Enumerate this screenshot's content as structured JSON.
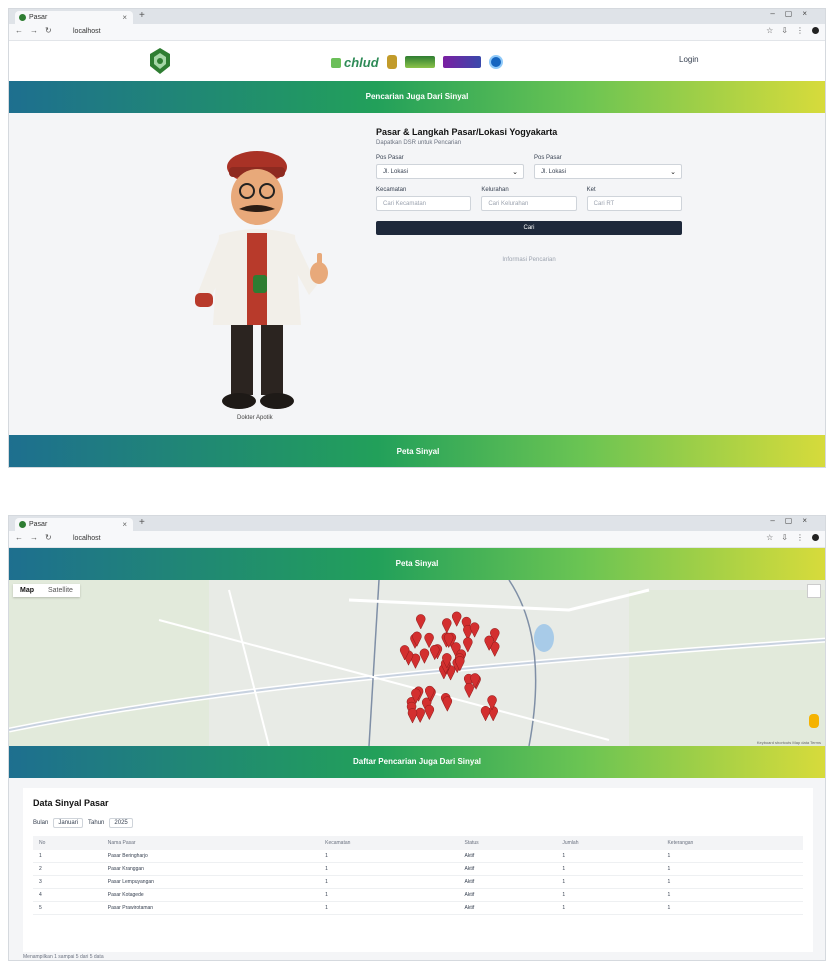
{
  "top": {
    "browser": {
      "tab_title": "Pasar",
      "url": "localhost"
    },
    "header": {
      "login": "Login"
    },
    "banner": "Pencarian Juga Dari Sinyal",
    "form": {
      "title": "Pasar & Langkah Pasar/Lokasi Yogyakarta",
      "subtitle": "Dapatkan DSR untuk Pencarian",
      "label_a": "Pos Pasar",
      "label_b": "Pos Pasar",
      "select_a": "Jl. Lokasi",
      "select_b": "Jl. Lokasi",
      "label_c": "Kecamatan",
      "label_d": "Kelurahan",
      "label_e": "Ket",
      "input_c_placeholder": "Cari Kecamatan",
      "input_d_placeholder": "Cari Kelurahan",
      "input_e_placeholder": "Cari RT",
      "button": "Cari",
      "note": "Informasi Pencarian"
    },
    "mascot_caption": "Dokter Apotik",
    "bottom_banner": "Peta Sinyal"
  },
  "bottom": {
    "browser": {
      "tab_title": "Pasar",
      "url": "localhost"
    },
    "banner": "Peta Sinyal",
    "map": {
      "tab_map": "Map",
      "tab_satellite": "Satellite",
      "attribution": "Keyboard shortcuts  Map data  Terms",
      "marker_color": "#d32f2f"
    },
    "banner2": "Daftar Pencarian Juga Dari Sinyal",
    "table": {
      "title": "Data Sinyal Pasar",
      "filter_a_label": "Bulan",
      "filter_a_value": "Januari",
      "filter_b_label": "Tahun",
      "filter_b_value": "2025",
      "headers": [
        "No",
        "Nama Pasar",
        "Kecamatan",
        "Status",
        "Jumlah",
        "Keterangan"
      ],
      "rows": [
        [
          "1",
          "Pasar Beringharjo",
          "1",
          "Aktif",
          "1",
          "1"
        ],
        [
          "2",
          "Pasar Kranggan",
          "1",
          "Aktif",
          "1",
          "1"
        ],
        [
          "3",
          "Pasar Lempuyangan",
          "1",
          "Aktif",
          "1",
          "1"
        ],
        [
          "4",
          "Pasar Kotagede",
          "1",
          "Aktif",
          "1",
          "1"
        ],
        [
          "5",
          "Pasar Prawirotaman",
          "1",
          "Aktif",
          "1",
          "1"
        ]
      ],
      "footer": "Menampilkan 1 sampai 5 dari 5 data"
    }
  }
}
